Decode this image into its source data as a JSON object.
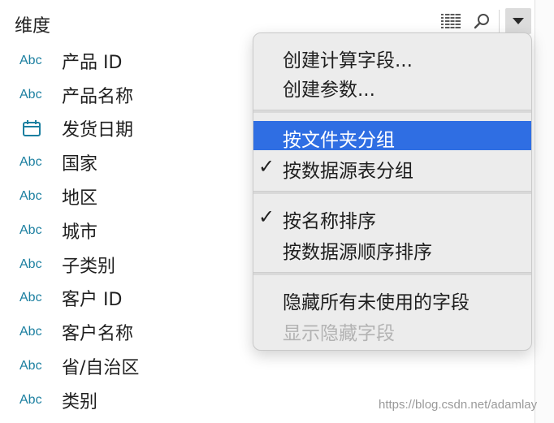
{
  "header": {
    "title": "维度",
    "icons": [
      "list-view-icon",
      "search-icon",
      "chevron-down-icon"
    ]
  },
  "fields": [
    {
      "type": "Abc",
      "name": "产品 ID"
    },
    {
      "type": "calendar",
      "name": "产品名称",
      "type_label": "Abc"
    },
    {
      "type": "calendar-icon",
      "name": "发货日期"
    },
    {
      "type": "Abc",
      "name": "国家"
    },
    {
      "type": "Abc",
      "name": "地区"
    },
    {
      "type": "Abc",
      "name": "城市"
    },
    {
      "type": "Abc",
      "name": "子类别"
    },
    {
      "type": "Abc",
      "name": "客户 ID"
    },
    {
      "type": "Abc",
      "name": "客户名称"
    },
    {
      "type": "Abc",
      "name": "省/自治区"
    },
    {
      "type": "Abc",
      "name": "类别"
    }
  ],
  "menu": {
    "items": [
      {
        "label": "创建计算字段...",
        "checked": false,
        "state": "normal"
      },
      {
        "label": "创建参数...",
        "checked": false,
        "state": "normal"
      },
      {
        "label": "按文件夹分组",
        "checked": false,
        "state": "highlighted"
      },
      {
        "label": "按数据源表分组",
        "checked": true,
        "state": "normal"
      },
      {
        "label": "按名称排序",
        "checked": true,
        "state": "normal"
      },
      {
        "label": "按数据源顺序排序",
        "checked": false,
        "state": "normal"
      },
      {
        "label": "隐藏所有未使用的字段",
        "checked": false,
        "state": "normal"
      },
      {
        "label": "显示隐藏字段",
        "checked": false,
        "state": "disabled"
      }
    ],
    "check_glyph": "✓"
  },
  "watermark": "https://blog.csdn.net/adamlay",
  "colors": {
    "type_label": "#1b7fa0",
    "highlight": "#2f6ee3",
    "menu_bg": "#ececec",
    "disabled": "#b3b3b3"
  }
}
